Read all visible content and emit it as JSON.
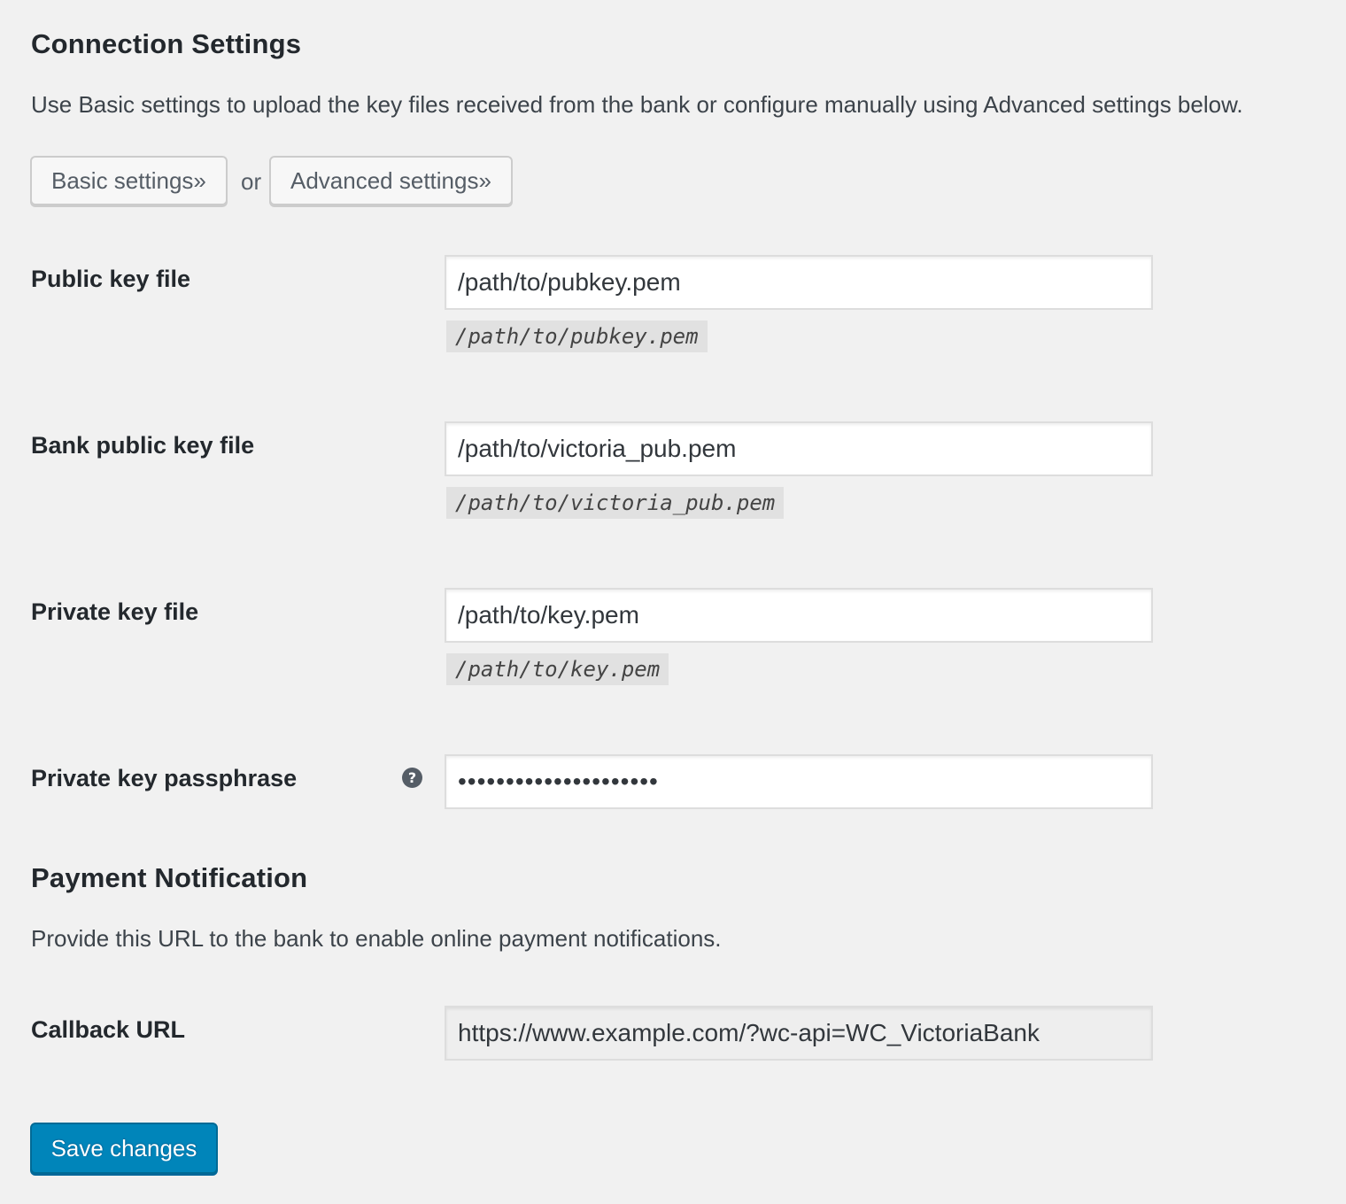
{
  "connection": {
    "heading": "Connection Settings",
    "description": "Use Basic settings to upload the key files received from the bank or configure manually using Advanced settings below.",
    "basic_button": "Basic settings»",
    "or_text": "or",
    "advanced_button": "Advanced settings»"
  },
  "fields": {
    "public_key": {
      "label": "Public key file",
      "value": "/path/to/pubkey.pem",
      "hint": "/path/to/pubkey.pem"
    },
    "bank_public_key": {
      "label": "Bank public key file",
      "value": "/path/to/victoria_pub.pem",
      "hint": "/path/to/victoria_pub.pem"
    },
    "private_key": {
      "label": "Private key file",
      "value": "/path/to/key.pem",
      "hint": "/path/to/key.pem"
    },
    "passphrase": {
      "label": "Private key passphrase",
      "value": "•••••••••••••••••••••",
      "help_icon": "question-circle-icon",
      "help_glyph": "?"
    }
  },
  "notification": {
    "heading": "Payment Notification",
    "description": "Provide this URL to the bank to enable online payment notifications.",
    "callback_label": "Callback URL",
    "callback_value": "https://www.example.com/?wc-api=WC_VictoriaBank"
  },
  "save_button": "Save changes",
  "colors": {
    "background": "#f1f1f1",
    "primary_button": "#0085ba",
    "text": "#23282d"
  }
}
